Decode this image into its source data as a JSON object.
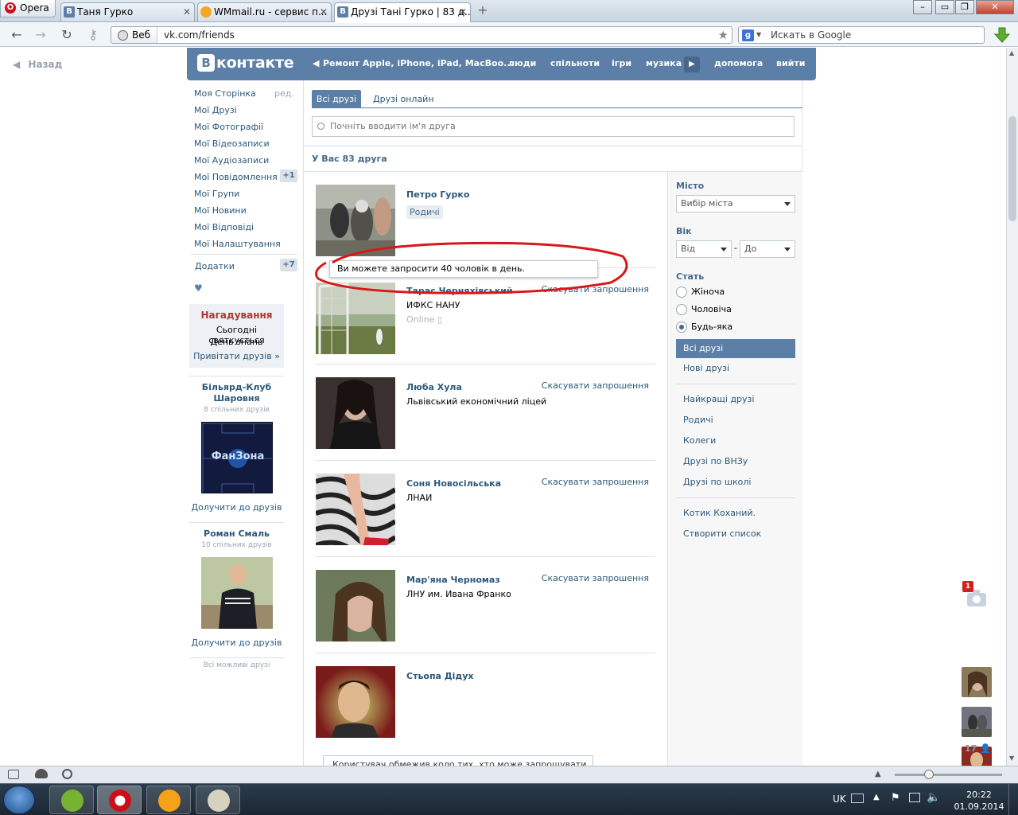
{
  "browser": {
    "app_button": "Opera",
    "tabs": [
      {
        "favicon": "В",
        "title": "Таня Гурко"
      },
      {
        "favicon": "",
        "title": "WMmail.ru - сервис п..."
      },
      {
        "favicon": "В",
        "title": "Друзі Тані Гурко | 83 д..."
      }
    ],
    "address_prefix": "Веб",
    "url": "vk.com/friends",
    "search_placeholder": "Искать в Google"
  },
  "vk": {
    "back": "Назад",
    "logo": "контакте",
    "logo_letter": "В",
    "top_menu": [
      "Ремонт Apple, iPhone, iPad, MacBoo...",
      "люди",
      "спільноти",
      "ігри",
      "музика",
      "допомога",
      "вийти"
    ],
    "left_menu": [
      {
        "label": "Моя Сторінка",
        "extra": "ред."
      },
      {
        "label": "Мої Друзі"
      },
      {
        "label": "Мої Фотографії"
      },
      {
        "label": "Мої Відеозаписи"
      },
      {
        "label": "Мої Аудіозаписи"
      },
      {
        "label": "Мої Повідомлення",
        "badge": "+1"
      },
      {
        "label": "Мої Групи"
      },
      {
        "label": "Мої Новини"
      },
      {
        "label": "Мої Відповіді"
      },
      {
        "label": "Мої Налаштування"
      }
    ],
    "apps": {
      "label": "Додатки",
      "badge": "+7"
    },
    "heart": "♥",
    "reminder": {
      "title": "Нагадування",
      "line1": "Сьогодні святкується",
      "line2": "День знань",
      "link": "Привітати друзів »"
    },
    "suggestions": [
      {
        "name": "Більярд-Клуб Шаровня",
        "mutual": "8 спільних друзів",
        "action": "Долучити до друзів",
        "image_text": "ФанЗона"
      },
      {
        "name": "Роман Смаль",
        "mutual": "10 спільних друзів",
        "action": "Долучити до друзів"
      }
    ],
    "all_possible": "Всі можливі друзі",
    "tabs": [
      "Всі друзі",
      "Друзі онлайн"
    ],
    "search_placeholder": "Почніть вводити ім'я друга",
    "count_header": "У Вас 83 друга",
    "friends": [
      {
        "name": "Петро Гурко",
        "tag": "Родичі"
      },
      {
        "name": "Тарас Черняхівський",
        "sub": "ИФКС НАНУ",
        "status": "Online",
        "action": "Скасувати запрошення"
      },
      {
        "name": "Люба Хула",
        "sub": "Львівський економічний ліцей",
        "action": "Скасувати запрошення"
      },
      {
        "name": "Соня Новосільська",
        "sub": "ЛНАИ",
        "action": "Скасувати запрошення"
      },
      {
        "name": "Мар'яна Черномаз",
        "sub": "ЛНУ им. Ивана Франко",
        "action": "Скасувати запрошення"
      },
      {
        "name": "Стьопа Дідух"
      }
    ],
    "tooltip": "Ви можете запросити 40 чоловік в день.",
    "tooltip_bottom": "Користувач обмежив коло тих, хто може запрошувати його",
    "filters": {
      "city_label": "Місто",
      "city_select": "Вибір міста",
      "age_label": "Вік",
      "age_from": "Від",
      "age_dash": "-",
      "age_to": "До",
      "gender_label": "Стать",
      "gender_options": [
        "Жіноча",
        "Чоловіча",
        "Будь-яка"
      ],
      "gender_selected": 2,
      "lists_group1": [
        "Всі друзі",
        "Нові друзі"
      ],
      "lists_group2": [
        "Найкращі друзі",
        "Родичі",
        "Колеги",
        "Друзі по ВНЗу",
        "Друзі по школі"
      ],
      "lists_group3": [
        "Котик Коханий.",
        "Створити список"
      ]
    },
    "quickbar": {
      "badge": "1",
      "count": "17"
    }
  },
  "taskbar": {
    "lang": "UK",
    "time": "20:22",
    "date": "01.09.2014"
  }
}
